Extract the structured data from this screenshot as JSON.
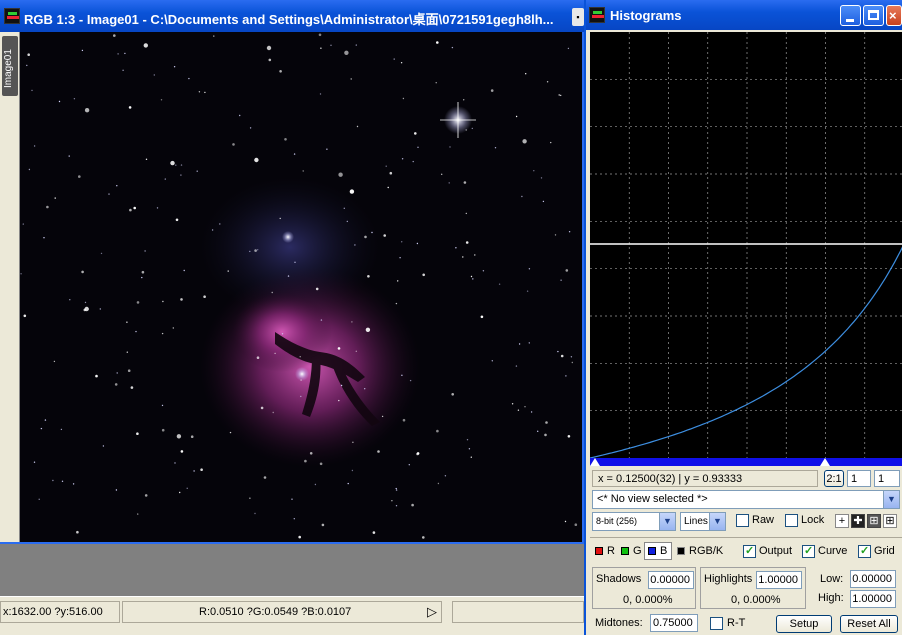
{
  "image_window": {
    "title": "RGB 1:3 - Image01 - C:\\Documents and Settings\\Administrator\\桌面\\0721591gegh8lh...",
    "side_tab": "Image01",
    "status": {
      "coords": "x:1632.00 ?y:516.00",
      "rgb": "R:0.0510 ?G:0.0549 ?B:0.0107"
    }
  },
  "histogram_window": {
    "title": "Histograms",
    "readout": "x = 0.12500(32) | y = 0.93333",
    "ratio_button": "2:1",
    "zoom_x": "1",
    "zoom_y": "1",
    "view_select": "<* No view selected *>",
    "bit_depth": "8-bit (256)",
    "draw_mode": "Lines",
    "raw_label": "Raw",
    "lock_label": "Lock",
    "channels": [
      {
        "label": "R",
        "color": "#e01010"
      },
      {
        "label": "G",
        "color": "#10c010"
      },
      {
        "label": "B",
        "color": "#1020e0"
      },
      {
        "label": "RGB/K",
        "color": "#000000"
      }
    ],
    "options": [
      {
        "label": "Output",
        "checked": true
      },
      {
        "label": "Curve",
        "checked": true
      },
      {
        "label": "Grid",
        "checked": true
      }
    ],
    "shadows_label": "Shadows",
    "shadows_value": "0.00000",
    "shadows_clip": "0,  0.000%",
    "highlights_label": "Highlights",
    "highlights_value": "1.00000",
    "highlights_clip": "0,  0.000%",
    "low_label": "Low:",
    "low_value": "0.00000",
    "high_label": "High:",
    "high_value": "1.00000",
    "midtones_label": "Midtones:",
    "midtones_value": "0.75000",
    "rt_label": "R-T",
    "setup_button": "Setup",
    "reset_button": "Reset All",
    "curve_color": "#3d8ee0"
  }
}
